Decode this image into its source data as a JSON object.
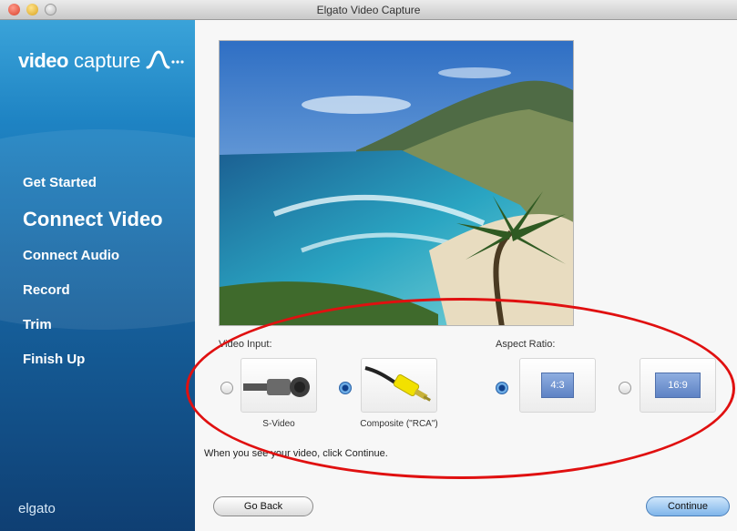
{
  "window": {
    "title": "Elgato Video Capture"
  },
  "sidebar": {
    "brand_bold": "video",
    "brand_thin": "capture",
    "items": [
      {
        "label": "Get Started"
      },
      {
        "label": "Connect Video"
      },
      {
        "label": "Connect Audio"
      },
      {
        "label": "Record"
      },
      {
        "label": "Trim"
      },
      {
        "label": "Finish Up"
      }
    ],
    "footer_logo": "elgato"
  },
  "main": {
    "video_input_label": "Video Input:",
    "aspect_ratio_label": "Aspect Ratio:",
    "inputs": [
      {
        "caption": "S-Video",
        "selected": false,
        "icon": "s-video-cable-icon"
      },
      {
        "caption": "Composite (\"RCA\")",
        "selected": true,
        "icon": "rca-cable-icon"
      }
    ],
    "ratios": [
      {
        "label": "4:3",
        "selected": true
      },
      {
        "label": "16:9",
        "selected": false
      }
    ],
    "instruction": "When you see your video, click Continue.",
    "go_back": "Go Back",
    "continue": "Continue"
  },
  "colors": {
    "sidebar_top": "#3aa3d9",
    "sidebar_bottom": "#0f3f73",
    "annotation": "#e01010"
  }
}
